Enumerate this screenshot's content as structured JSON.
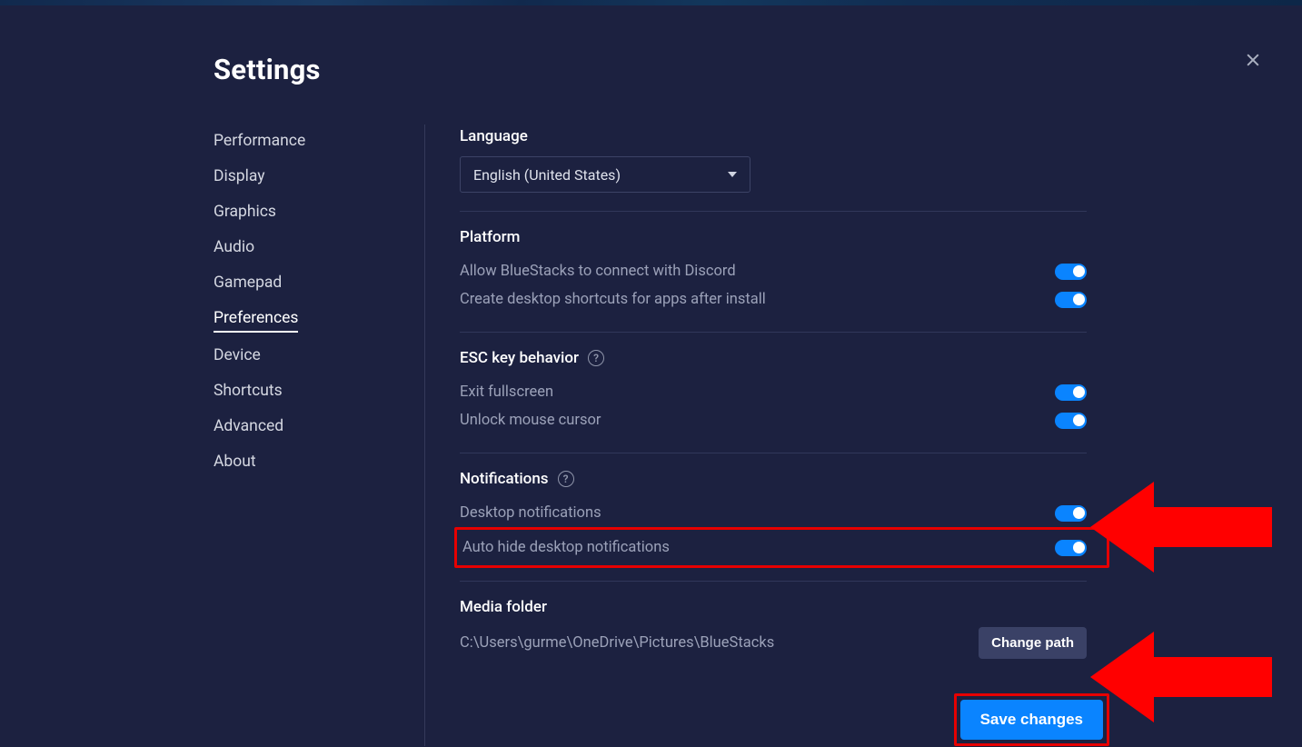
{
  "title": "Settings",
  "sidebar": {
    "items": [
      {
        "label": "Performance"
      },
      {
        "label": "Display"
      },
      {
        "label": "Graphics"
      },
      {
        "label": "Audio"
      },
      {
        "label": "Gamepad"
      },
      {
        "label": "Preferences"
      },
      {
        "label": "Device"
      },
      {
        "label": "Shortcuts"
      },
      {
        "label": "Advanced"
      },
      {
        "label": "About"
      }
    ],
    "active_index": 5
  },
  "language": {
    "label": "Language",
    "selected": "English (United States)"
  },
  "platform": {
    "label": "Platform",
    "discord_label": "Allow BlueStacks to connect with Discord",
    "discord_on": true,
    "shortcuts_label": "Create desktop shortcuts for apps after install",
    "shortcuts_on": true
  },
  "esc": {
    "label": "ESC key behavior",
    "exit_fullscreen_label": "Exit fullscreen",
    "exit_fullscreen_on": true,
    "unlock_cursor_label": "Unlock mouse cursor",
    "unlock_cursor_on": true
  },
  "notifications": {
    "label": "Notifications",
    "desktop_label": "Desktop notifications",
    "desktop_on": true,
    "autohide_label": "Auto hide desktop notifications",
    "autohide_on": true
  },
  "media": {
    "label": "Media folder",
    "path": "C:\\Users\\gurme\\OneDrive\\Pictures\\BlueStacks",
    "change_label": "Change path"
  },
  "save_label": "Save changes"
}
